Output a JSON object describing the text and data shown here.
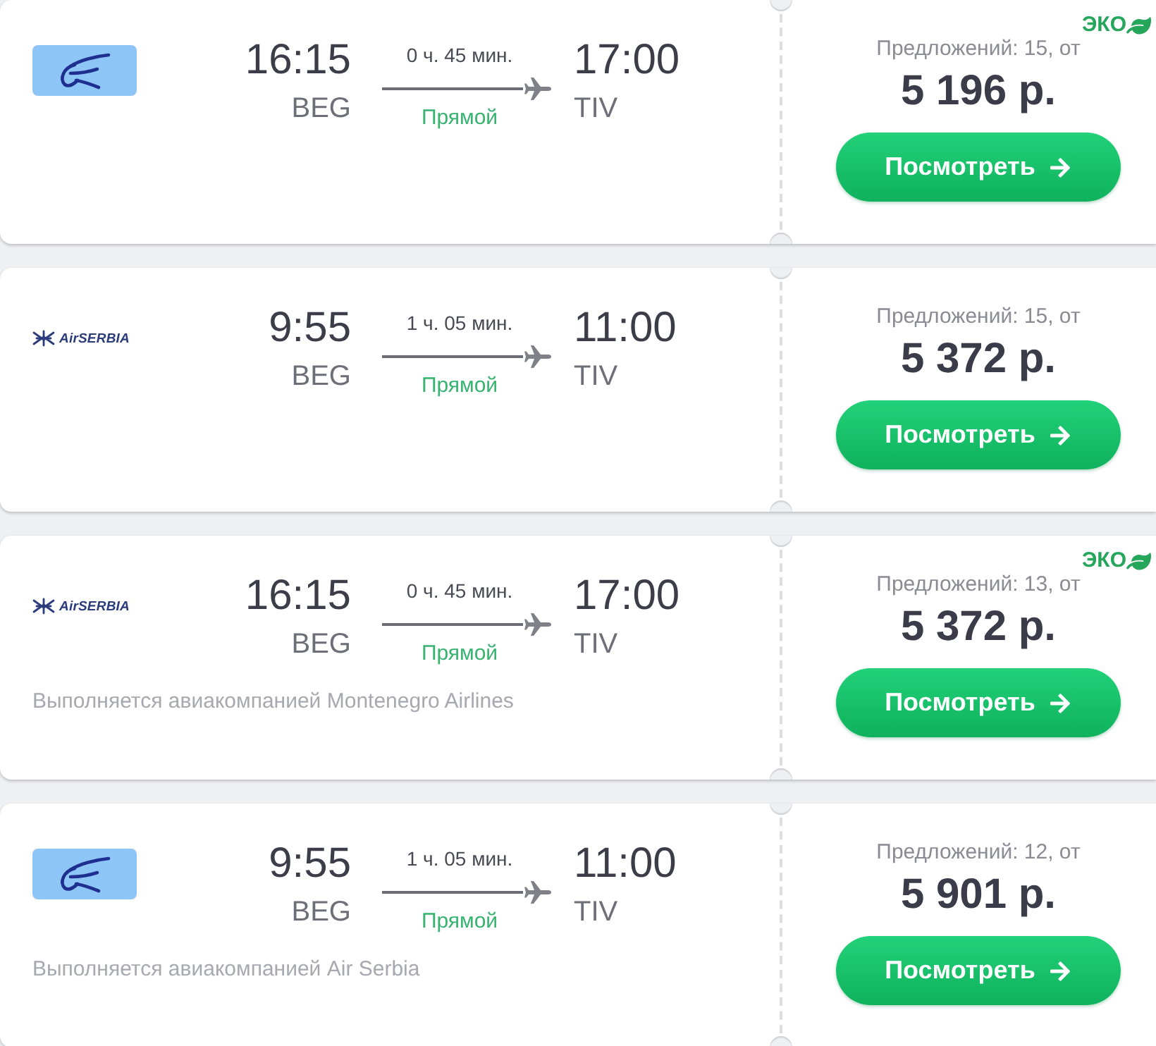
{
  "flights": [
    {
      "airline_logo": {
        "kind": "tile"
      },
      "departure": {
        "time": "16:15",
        "airport": "BEG"
      },
      "duration": "0 ч. 45 мин.",
      "stops": "Прямой",
      "arrival": {
        "time": "17:00",
        "airport": "TIV"
      },
      "eco_badge": "ЭКО",
      "offers": "Предложений: 15, от",
      "price": "5 196 р.",
      "button": "Посмотреть"
    },
    {
      "airline_logo": {
        "kind": "wordmark",
        "text": "AirSERBIA"
      },
      "departure": {
        "time": "9:55",
        "airport": "BEG"
      },
      "duration": "1 ч. 05 мин.",
      "stops": "Прямой",
      "arrival": {
        "time": "11:00",
        "airport": "TIV"
      },
      "offers": "Предложений: 15, от",
      "price": "5 372 р.",
      "button": "Посмотреть"
    },
    {
      "airline_logo": {
        "kind": "wordmark",
        "text": "AirSERBIA"
      },
      "departure": {
        "time": "16:15",
        "airport": "BEG"
      },
      "duration": "0 ч. 45 мин.",
      "stops": "Прямой",
      "arrival": {
        "time": "17:00",
        "airport": "TIV"
      },
      "operated_by": "Выполняется авиакомпанией Montenegro Airlines",
      "eco_badge": "ЭКО",
      "offers": "Предложений: 13, от",
      "price": "5 372 р.",
      "button": "Посмотреть"
    },
    {
      "airline_logo": {
        "kind": "tile"
      },
      "departure": {
        "time": "9:55",
        "airport": "BEG"
      },
      "duration": "1 ч. 05 мин.",
      "stops": "Прямой",
      "arrival": {
        "time": "11:00",
        "airport": "TIV"
      },
      "operated_by": "Выполняется авиакомпанией Air Serbia",
      "offers": "Предложений: 12, от",
      "price": "5 901 р.",
      "button": "Посмотреть"
    }
  ]
}
